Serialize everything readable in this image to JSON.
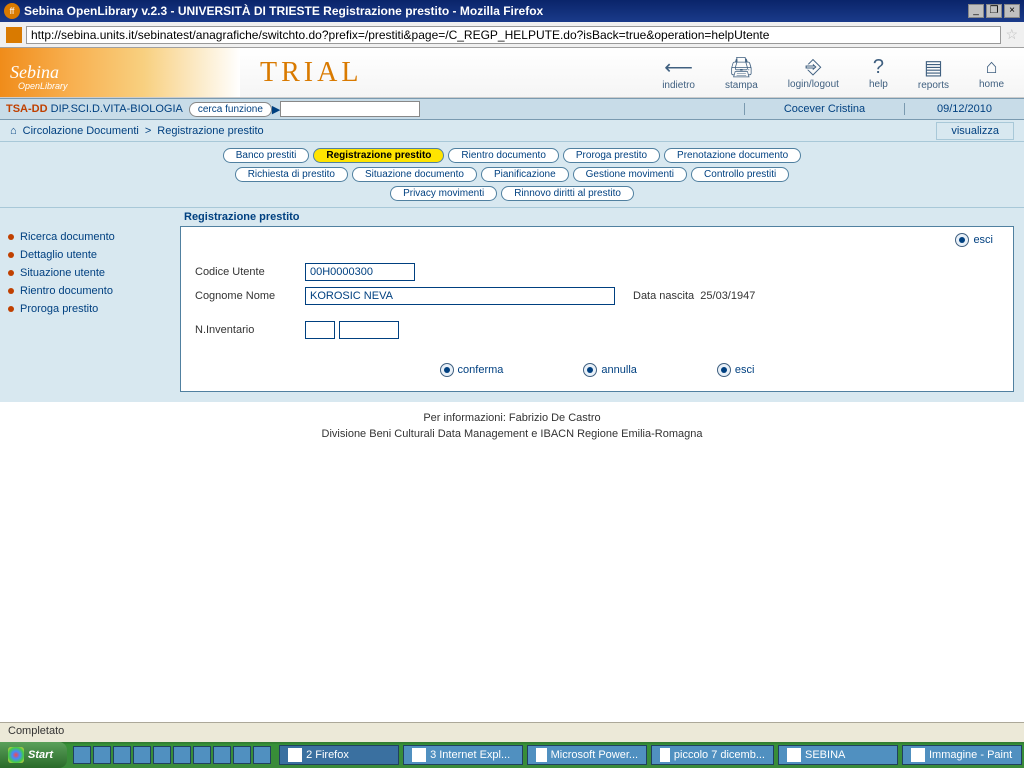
{
  "window": {
    "title": "Sebina OpenLibrary v.2.3 - UNIVERSITÀ DI TRIESTE Registrazione prestito - Mozilla Firefox",
    "url": "http://sebina.units.it/sebinatest/anagrafiche/switchto.do?prefix=/prestiti&page=/C_REGP_HELPUTE.do?isBack=true&operation=helpUtente"
  },
  "header": {
    "logo": "Sebina",
    "logo_sub": "OpenLibrary",
    "trial": "Trial",
    "buttons": {
      "back": "indietro",
      "print": "stampa",
      "login": "login/logout",
      "help": "help",
      "reports": "reports",
      "home": "home"
    }
  },
  "infobar": {
    "inst_code": "TSA-DD",
    "inst_name": "DIP.SCI.D.VITA-BIOLOGIA",
    "search_label": "cerca funzione",
    "user": "Cocever Cristina",
    "date": "09/12/2010"
  },
  "breadcrumb": {
    "l1": "Circolazione Documenti",
    "l2": "Registrazione prestito",
    "visualizza": "visualizza"
  },
  "tabs": {
    "row1": [
      "Banco prestiti",
      "Registrazione prestito",
      "Rientro documento",
      "Proroga prestito",
      "Prenotazione documento"
    ],
    "row2": [
      "Richiesta di prestito",
      "Situazione documento",
      "Pianificazione",
      "Gestione movimenti",
      "Controllo prestiti"
    ],
    "row3": [
      "Privacy movimenti",
      "Rinnovo diritti al prestito"
    ],
    "active": "Registrazione prestito"
  },
  "sidebar": [
    "Ricerca documento",
    "Dettaglio utente",
    "Situazione utente",
    "Rientro documento",
    "Proroga prestito"
  ],
  "panel": {
    "title": "Registrazione prestito",
    "esci": "esci",
    "codice_utente_lbl": "Codice Utente",
    "codice_utente_val": "00H0000300",
    "cognome_lbl": "Cognome Nome",
    "cognome_val": "KOROSIC NEVA",
    "nascita_lbl": "Data nascita",
    "nascita_val": "25/03/1947",
    "inventario_lbl": "N.Inventario",
    "conferma": "conferma",
    "annulla": "annulla"
  },
  "footer": {
    "line1": "Per informazioni: Fabrizio De Castro",
    "line2": "Divisione Beni Culturali Data Management  e  IBACN Regione Emilia-Romagna"
  },
  "statusbar": "Completato",
  "taskbar": {
    "start": "Start",
    "items": [
      "2 Firefox",
      "3 Internet Expl...",
      "Microsoft Power...",
      "piccolo 7 dicemb...",
      "SEBINA",
      "Immagine - Paint"
    ]
  }
}
